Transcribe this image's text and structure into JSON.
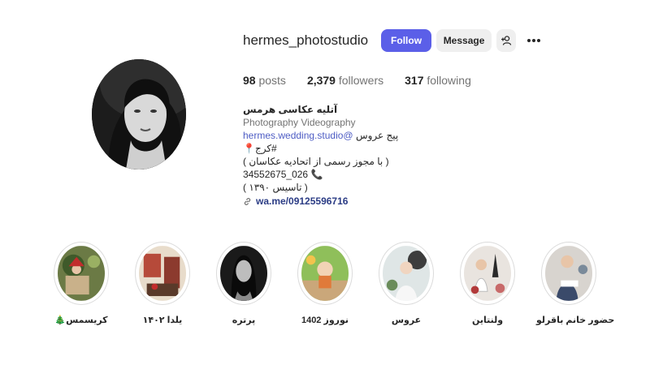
{
  "profile": {
    "username": "hermes_photostudio",
    "follow_label": "Follow",
    "message_label": "Message",
    "add_user_icon": "person-plus-icon",
    "more_icon": "more-horizontal-icon"
  },
  "stats": {
    "posts_count": "98",
    "posts_label": "posts",
    "followers_count": "2,379",
    "followers_label": "followers",
    "following_count": "317",
    "following_label": "following"
  },
  "bio": {
    "name": "آتلیه عکاسی هرمس",
    "category": "Photography Videography",
    "line1_mention": "hermes.wedding.studio@",
    "line1_text": "پیج عروس",
    "line2": "کرج#",
    "line3": "( با مجوز رسمی از اتحادیه عکاسان )",
    "line4": "34552675_026",
    "line5": "( تاسیس ۱۳۹۰ )",
    "link": "wa.me/09125596716"
  },
  "highlights": [
    {
      "label": "🎄کریسمس"
    },
    {
      "label": "یلدا ۱۴۰۲"
    },
    {
      "label": "پرتره"
    },
    {
      "label": "نوروز 1402"
    },
    {
      "label": "عروس"
    },
    {
      "label": "ولنتاین"
    },
    {
      "label": "حضور خانم باقرلو"
    }
  ],
  "colors": {
    "follow_button": "#5b5fe8",
    "secondary_button": "#efefef",
    "link": "#2b3c85"
  }
}
